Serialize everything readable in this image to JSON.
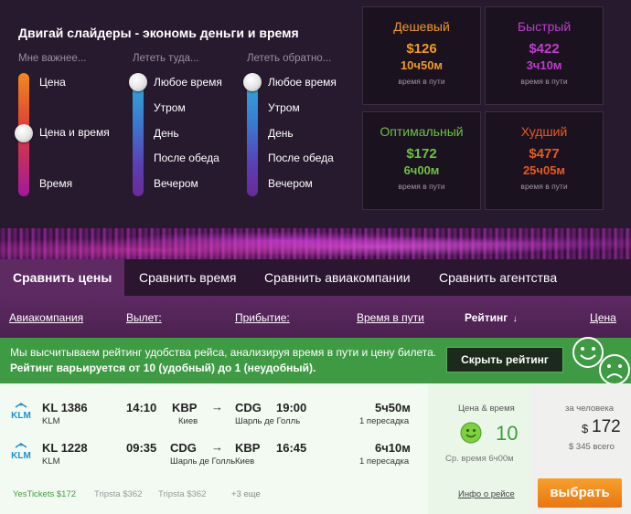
{
  "sliders": {
    "title": "Двигай слайдеры - экономь деньги и время",
    "preference": {
      "header": "Мне важнее...",
      "options": [
        "Цена",
        "Цена и время",
        "Время"
      ]
    },
    "departure": {
      "header": "Лететь туда...",
      "options": [
        "Любое время",
        "Утром",
        "День",
        "После обеда",
        "Вечером"
      ]
    },
    "return": {
      "header": "Лететь обратно...",
      "options": [
        "Любое время",
        "Утром",
        "День",
        "После обеда",
        "Вечером"
      ]
    }
  },
  "summary_cards": [
    {
      "title": "Дешевый",
      "price": "$126",
      "duration": "10ч50м",
      "note": "время в пути",
      "color": "#f29a1c"
    },
    {
      "title": "Быстрый",
      "price": "$422",
      "duration": "3ч10м",
      "note": "время в пути",
      "color": "#c13ad0"
    },
    {
      "title": "Оптимальный",
      "price": "$172",
      "duration": "6ч00м",
      "note": "время в пути",
      "color": "#6cc241"
    },
    {
      "title": "Худший",
      "price": "$477",
      "duration": "25ч05м",
      "note": "время в пути",
      "color": "#e85a1c"
    }
  ],
  "tabs": [
    "Сравнить цены",
    "Сравнить время",
    "Сравнить авиакомпании",
    "Сравнить агентства"
  ],
  "sort": {
    "airline": "Авиакомпания",
    "departure": "Вылет:",
    "arrival": "Прибытие:",
    "duration": "Время в пути",
    "rating": "Рейтинг",
    "rating_arrow": "↓",
    "price": "Цена"
  },
  "info": {
    "text": "Мы высчитываем рейтинг удобства рейса, анализируя время в пути и цену билета.",
    "bold_text": "Рейтинг варьируется от 10 (удобный) до 1 (неудобный).",
    "button": "Скрыть рейтинг"
  },
  "result": {
    "legs": [
      {
        "airline_logo": "KLM",
        "flight": "KL 1386",
        "carrier": "KLM",
        "dep_time": "14:10",
        "dep_code": "KBP",
        "dep_city": "Киев",
        "arrow": "→",
        "arr_code": "CDG",
        "arr_time": "19:00",
        "arr_city": "Шарль де Голль",
        "duration": "5ч50м",
        "stops": "1 пересадка"
      },
      {
        "airline_logo": "KLM",
        "flight": "KL 1228",
        "carrier": "KLM",
        "dep_time": "09:35",
        "dep_code": "CDG",
        "dep_city": "Шарль де Голль",
        "arrow": "→",
        "arr_code": "KBP",
        "arr_time": "16:45",
        "arr_city": "Киев",
        "duration": "6ч10м",
        "stops": "1 пересадка"
      }
    ],
    "rating_label": "Цена & время",
    "rating_value": "10",
    "avg_time": "Ср. время 6ч00м",
    "per_person": "за человека",
    "currency": "$",
    "price": "172",
    "total": "$ 345 всего",
    "offers": [
      {
        "label": "YesTickets $172",
        "color": "#3e9e3a"
      },
      {
        "label": "Tripsta $362",
        "color": "#999999"
      },
      {
        "label": "Tripsta $362",
        "color": "#999999"
      },
      {
        "label": "+3 еще",
        "color": "#888888"
      }
    ],
    "info_link": "Инфо о рейсе",
    "select_button": "выбрать"
  }
}
